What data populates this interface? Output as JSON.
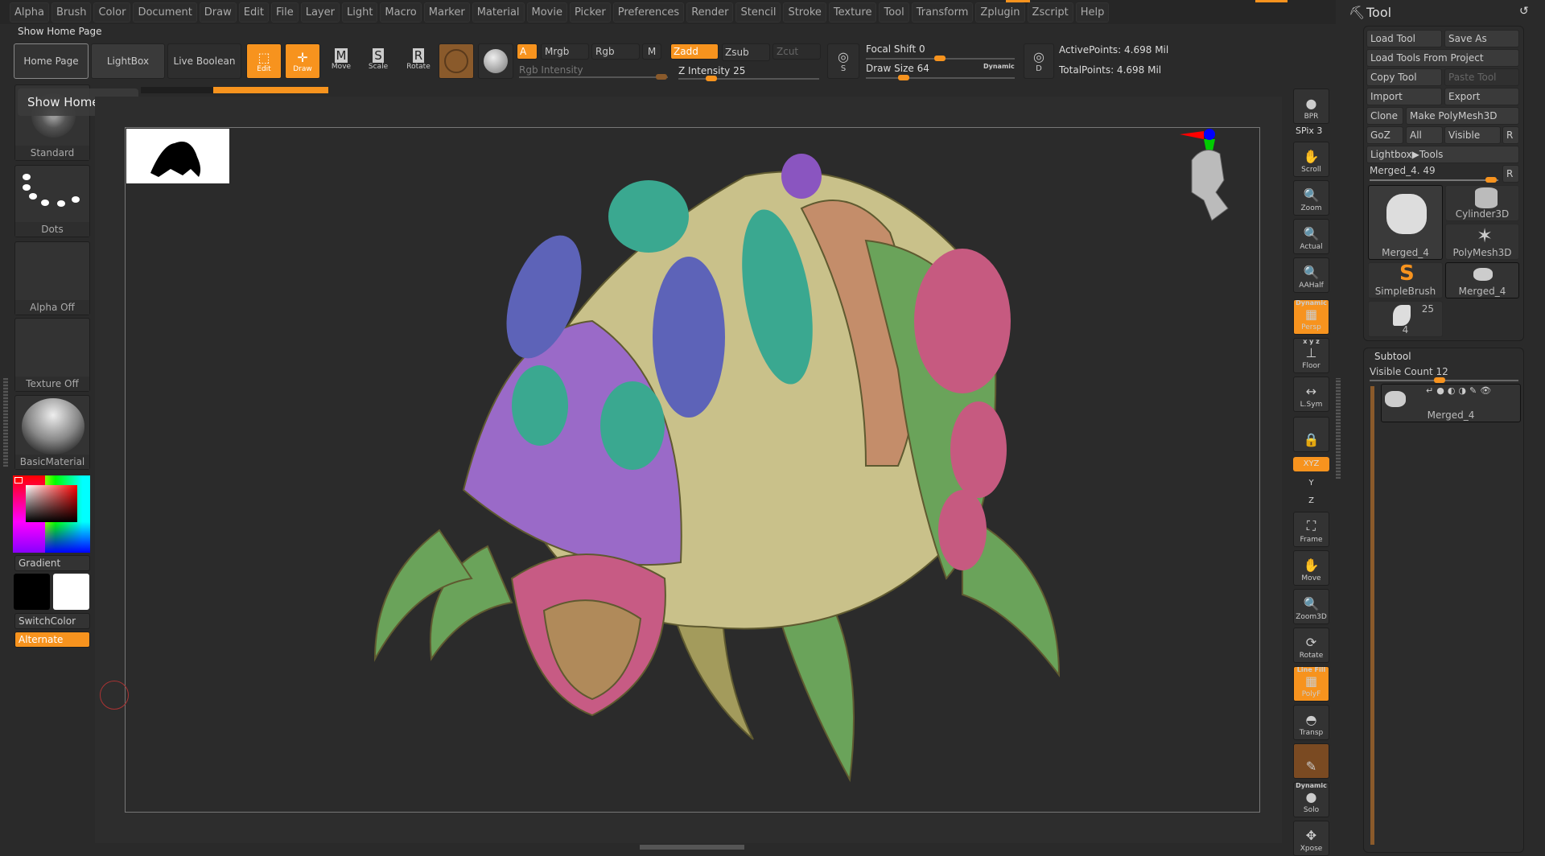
{
  "menu": [
    "Alpha",
    "Brush",
    "Color",
    "Document",
    "Draw",
    "Edit",
    "File",
    "Layer",
    "Light",
    "Macro",
    "Marker",
    "Material",
    "Movie",
    "Picker",
    "Preferences",
    "Render",
    "Stencil",
    "Stroke",
    "Texture",
    "Tool",
    "Transform",
    "Zplugin",
    "Zscript",
    "Help"
  ],
  "subtitle": "Show Home Page",
  "toolbar": {
    "home": "Home Page",
    "lightbox": "LightBox",
    "live_boolean": "Live Boolean",
    "edit": "Edit",
    "draw": "Draw",
    "move": "Move",
    "scale": "Scale",
    "rotate": "Rotate",
    "a": "A",
    "mrgb": "Mrgb",
    "rgb": "Rgb",
    "m": "M",
    "zadd": "Zadd",
    "zsub": "Zsub",
    "zcut": "Zcut",
    "rgb_intensity": "Rgb Intensity",
    "z_intensity": "Z Intensity 25",
    "focal_shift": "Focal Shift 0",
    "draw_size": "Draw Size 64",
    "dynamic": "Dynamic",
    "active_points": "ActivePoints: 4.698 Mil",
    "total_points": "TotalPoints: 4.698 Mil",
    "s": "S",
    "d": "D",
    "z_intensity_value": 25,
    "focal_shift_value": 0,
    "draw_size_value": 64
  },
  "tooltip": "Show Home Page",
  "left": {
    "brush": "Standard",
    "stroke": "Dots",
    "alpha": "Alpha Off",
    "texture": "Texture Off",
    "material": "BasicMaterial",
    "gradient": "Gradient",
    "switch": "SwitchColor",
    "alternate": "Alternate",
    "main_color": "#000000",
    "secondary_color": "#ffffff",
    "picked_color": "#ff0000"
  },
  "right_toolbar": [
    {
      "label": "BPR",
      "icon": "bpr-sphere-icon"
    },
    {
      "label": "Scroll",
      "icon": "hand-icon"
    },
    {
      "label": "Zoom",
      "icon": "magnifier-icon"
    },
    {
      "label": "Actual",
      "icon": "magnifier-x1-icon"
    },
    {
      "label": "AAHalf",
      "icon": "magnifier-half-icon"
    },
    {
      "label": "Persp",
      "icon": "perspective-grid-icon",
      "top": "Dynamic",
      "active": true
    },
    {
      "label": "Floor",
      "icon": "floor-icon",
      "top": "x y z"
    },
    {
      "label": "L.Sym",
      "icon": "symmetry-icon"
    },
    {
      "label": "",
      "icon": "camera-lock-icon"
    },
    {
      "label": "Frame",
      "icon": "frame-icon"
    },
    {
      "label": "Move",
      "icon": "hand-move-icon"
    },
    {
      "label": "Zoom3D",
      "icon": "zoom3d-icon"
    },
    {
      "label": "Rotate",
      "icon": "rotate-icon"
    },
    {
      "label": "PolyF",
      "icon": "polyframe-icon",
      "top": "Line Fill",
      "active": true
    },
    {
      "label": "Transp",
      "icon": "transparency-icon"
    },
    {
      "label": "",
      "icon": "ghost-icon"
    },
    {
      "label": "Solo",
      "icon": "solo-icon",
      "top": "Dynamic"
    },
    {
      "label": "Xpose",
      "icon": "xpose-icon"
    }
  ],
  "spix": "SPix 3",
  "xyz": "XYZ",
  "y": "Y",
  "z": "Z",
  "tool_panel": {
    "title": "Tool",
    "load_tool": "Load Tool",
    "save_as": "Save As",
    "load_project": "Load Tools From Project",
    "copy_tool": "Copy Tool",
    "paste_tool": "Paste Tool",
    "import": "Import",
    "export": "Export",
    "clone": "Clone",
    "make_polymesh": "Make PolyMesh3D",
    "goz": "GoZ",
    "all": "All",
    "visible": "Visible",
    "r": "R",
    "lightbox_tools": "Lightbox▶Tools",
    "current": "Merged_4. 49",
    "thumbs": [
      {
        "label": "Merged_4"
      },
      {
        "label": "Cylinder3D"
      },
      {
        "label": "PolyMesh3D"
      },
      {
        "label": "SimpleBrush"
      },
      {
        "label": "Merged_4"
      },
      {
        "label": "4",
        "badge": "25"
      }
    ]
  },
  "subtool": {
    "title": "Subtool",
    "visible_count": "Visible Count 12",
    "item": "Merged_4",
    "visible_count_value": 12
  }
}
